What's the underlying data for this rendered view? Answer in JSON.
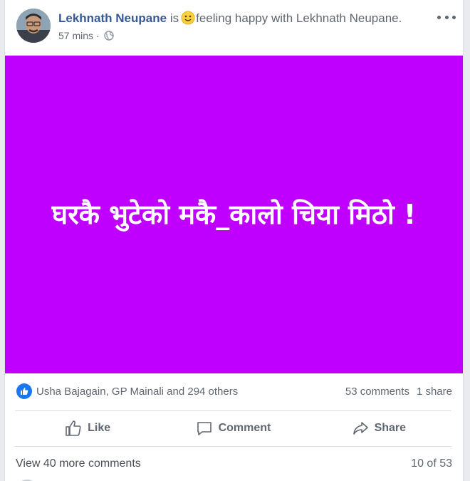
{
  "post": {
    "author": "Lekhnath Neupane",
    "is_word": "is",
    "feeling_text": "feeling happy with Lekhnath Neupane.",
    "time": "57 mins",
    "privacy_icon": "globe-icon",
    "status_text": "घरकै भुटेको मकै_कालो चिया मिठो !",
    "status_bg": "#bf00ff"
  },
  "reactions": {
    "icon": "like-badge-icon",
    "names": "Usha Bajagain, GP Mainali and 294 others",
    "comments": "53 comments",
    "shares": "1 share"
  },
  "actions": {
    "like": "Like",
    "comment": "Comment",
    "share": "Share"
  },
  "comments": {
    "view_more": "View 40 more comments",
    "count": "10 of 53"
  },
  "colors": {
    "accent": "#365899",
    "like_blue": "#1877f2"
  }
}
